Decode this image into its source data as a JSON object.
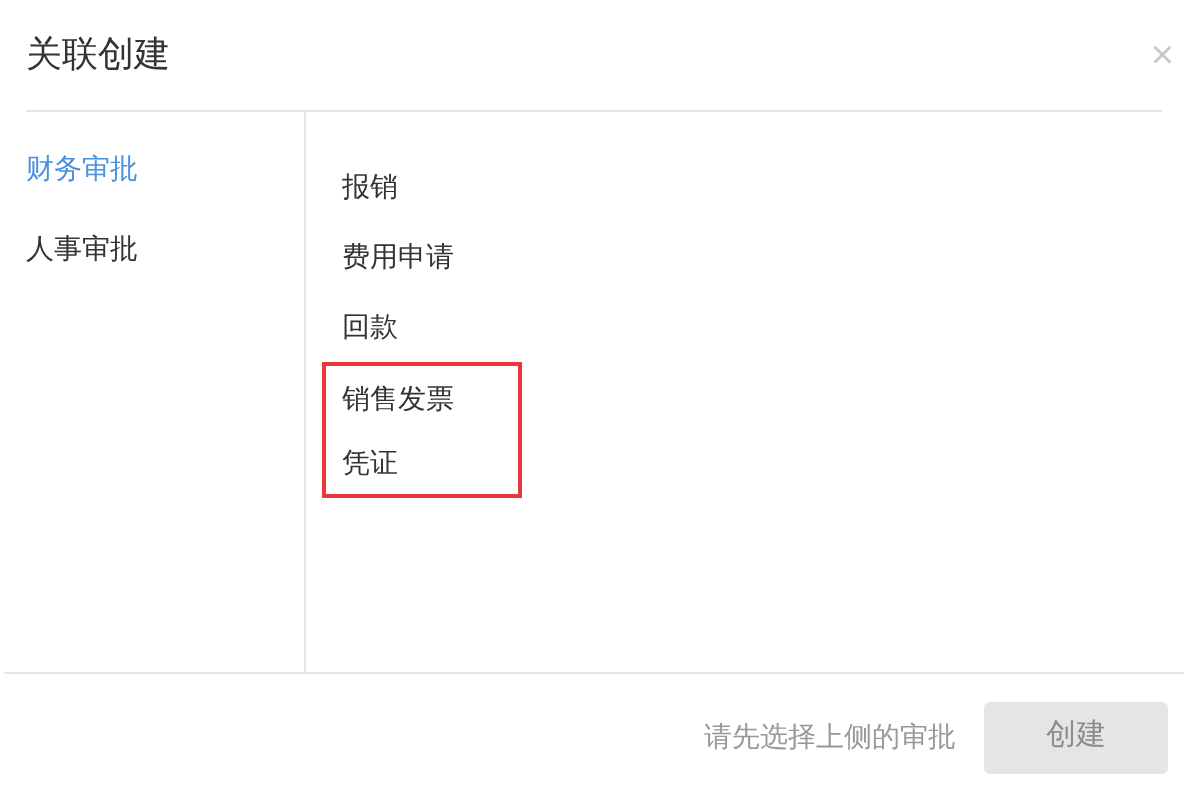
{
  "dialog": {
    "title": "关联创建",
    "close": "×"
  },
  "categories": [
    {
      "label": "财务审批",
      "selected": true
    },
    {
      "label": "人事审批",
      "selected": false
    }
  ],
  "types": [
    {
      "label": "报销",
      "highlighted": false
    },
    {
      "label": "费用申请",
      "highlighted": false
    },
    {
      "label": "回款",
      "highlighted": false
    },
    {
      "label": "销售发票",
      "highlighted": true
    },
    {
      "label": "凭证",
      "highlighted": true
    }
  ],
  "footer": {
    "hint": "请先选择上侧的审批",
    "button": {
      "label": "创建",
      "disabled": true
    }
  }
}
